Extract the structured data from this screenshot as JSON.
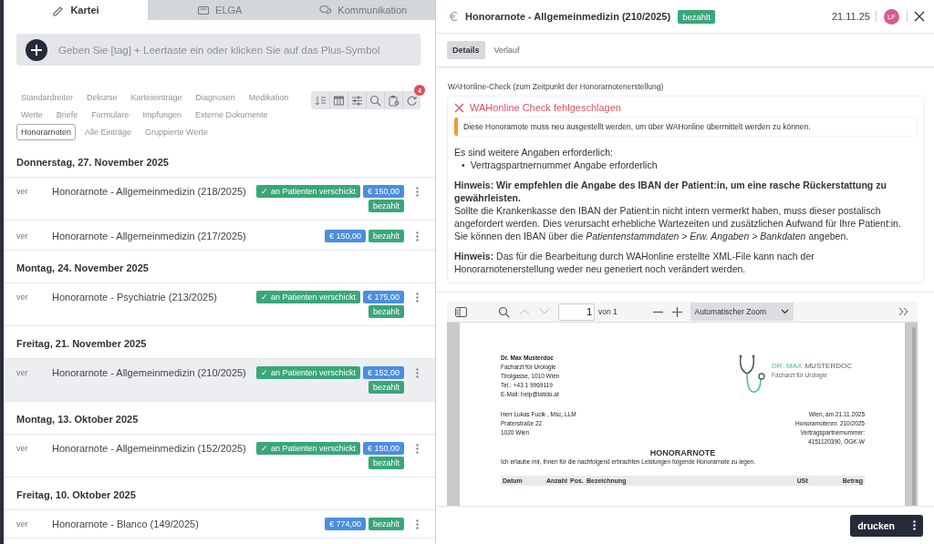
{
  "left_tabs": [
    {
      "label": "Kartei",
      "kind": "pencil",
      "selected": true
    },
    {
      "label": "ELGA",
      "kind": "card",
      "selected": false
    },
    {
      "label": "Kommunikation",
      "kind": "chat",
      "selected": false
    }
  ],
  "tag_input": {
    "placeholder": "Geben Sie [tag] + Leertaste ein oder klicken Sie auf das Plus-Symbol"
  },
  "filter_rows": [
    [
      {
        "label": "Standardreiter",
        "selected": false
      },
      {
        "label": "Dekurse",
        "selected": false
      },
      {
        "label": "Karteieintrage",
        "selected": false
      },
      {
        "label": "Diagnosen",
        "selected": false
      },
      {
        "label": "Medikation",
        "selected": false
      }
    ],
    [
      {
        "label": "Werte",
        "selected": false
      },
      {
        "label": "Briefe",
        "selected": false
      },
      {
        "label": "Formulare",
        "selected": false
      },
      {
        "label": "Impfungen",
        "selected": false
      },
      {
        "label": "Externe Dokumente",
        "selected": false
      }
    ],
    [
      {
        "label": "Honorarnoten",
        "selected": true
      },
      {
        "label": "Alle Einträge",
        "selected": false
      },
      {
        "label": "Gruppierte Werte",
        "selected": false
      }
    ]
  ],
  "toolbar": {
    "badge": "4"
  },
  "groups": [
    {
      "date": "Donnerstag, 27. November 2025",
      "entries": [
        {
          "prefix": "ver",
          "title": "Honorarnote - Allgemeinmedizin (218/2025)",
          "sent": "✓ an Patienten verschickt",
          "amount": "€ 150,00",
          "status": "bezahlt",
          "selected": false
        },
        {
          "prefix": "ver",
          "title": "Honorarnote - Allgemeinmedizin (217/2025)",
          "amount": "€ 150,00",
          "status": "bezahlt",
          "selected": false
        }
      ]
    },
    {
      "date": "Montag, 24. November 2025",
      "entries": [
        {
          "prefix": "ver",
          "title": "Honorarnote - Psychiatrie (213/2025)",
          "sent": "✓ an Patienten verschickt",
          "amount": "€ 175,00",
          "status": "bezahlt",
          "selected": false
        }
      ]
    },
    {
      "date": "Freitag, 21. November 2025",
      "entries": [
        {
          "prefix": "ver",
          "title": "Honorarnote - Allgemeinmedizin (210/2025)",
          "sent": "✓ an Patienten verschickt",
          "amount": "€ 152,00",
          "status": "bezahlt",
          "selected": true
        }
      ]
    },
    {
      "date": "Montag, 13. Oktober 2025",
      "entries": [
        {
          "prefix": "ver",
          "title": "Honorarnote - Allgemeinmedizin (152/2025)",
          "sent": "✓ an Patienten verschickt",
          "amount": "€ 150,00",
          "status": "bezahlt",
          "selected": false
        }
      ]
    },
    {
      "date": "Freitag, 10. Oktober 2025",
      "entries": [
        {
          "prefix": "ver",
          "title": "Honorarnote - Blanco (149/2025)",
          "amount": "€ 774,00",
          "status": "bezahlt",
          "selected": false
        }
      ]
    }
  ],
  "detail": {
    "title": "Honorarnote - Allgemeinmedizin (210/2025)",
    "status": "bezahlt",
    "date": "21.11.25",
    "avatar": "LF",
    "tabs": [
      {
        "label": "Details",
        "selected": true
      },
      {
        "label": "Verlauf",
        "selected": false
      }
    ],
    "check_label": "WAHonline-Check (zum Zeitpunkt der Honorarnotenerstellung)",
    "check_title": "WAHonline Check fehlgeschlagen",
    "warning": "Diese Honorarnote muss neu ausgestellt werden, um über WAHonline übermittelt werden zu können.",
    "intro": "Es sind weitere Angaben erforderlich:",
    "bullets": [
      {
        "marker": "•",
        "text": "Vertragspartnernummer Angabe erforderlich"
      }
    ],
    "hint_lead": "Hinweis: Wir empfehlen die Angabe des IBAN der Patient:in, um eine rasche Rückerstattung zu gewährleisten.",
    "hint_body": "Sollte die Krankenkasse den IBAN der Patient:in nicht intern vermerkt haben, muss dieser postalisch angefordert werden. Dies verursacht erhebliche Wartezeiten und zusätzlichen Aufwand für Ihre Patient:in. Sie können den IBAN über die *Patientenstammdaten > Erw. Angaben > Bankdaten* angeben.",
    "hint2": "**Hinweis:** Das für die Bearbeitung durch WAHonline erstellte XML-File kann nach der Honorarnotenerstellung weder neu generiert noch verändert werden."
  },
  "pdf": {
    "page": "1",
    "page_count": "von 1",
    "zoom": "Automatischer Zoom",
    "sender": [
      "Dr. Max Musterdoc",
      "Facharzt für Urologie",
      "Tirolgasse, 1010 Wien",
      "Tel.: +43 1 9969119",
      "E-Mail: help@latido.at"
    ],
    "logo_first": "DR. MAX",
    "logo_second": "MUSTERDOC",
    "logo_sub": "Facharzt für Urologie",
    "recipient": [
      "Herr Lukas Fucik , Msc, LLM",
      "Praterstraße 22",
      "1020 Wien"
    ],
    "meta": [
      "Wien, am 21.11.2025",
      "Honorarnotennr. 210/2025",
      "Vertragspartnernummer:",
      "4151120390, ÖGK-W"
    ],
    "heading": "HONORARNOTE",
    "intro": "Ich erlaube mir, Ihnen für die nachfolgend erbrachten Leistungen folgende Honorarnote zu legen.",
    "columns": [
      "Datum",
      "Anzahl",
      "Pos.",
      "Bezeichnung",
      "USt",
      "Betrag"
    ]
  },
  "footer": {
    "button": "drucken"
  }
}
